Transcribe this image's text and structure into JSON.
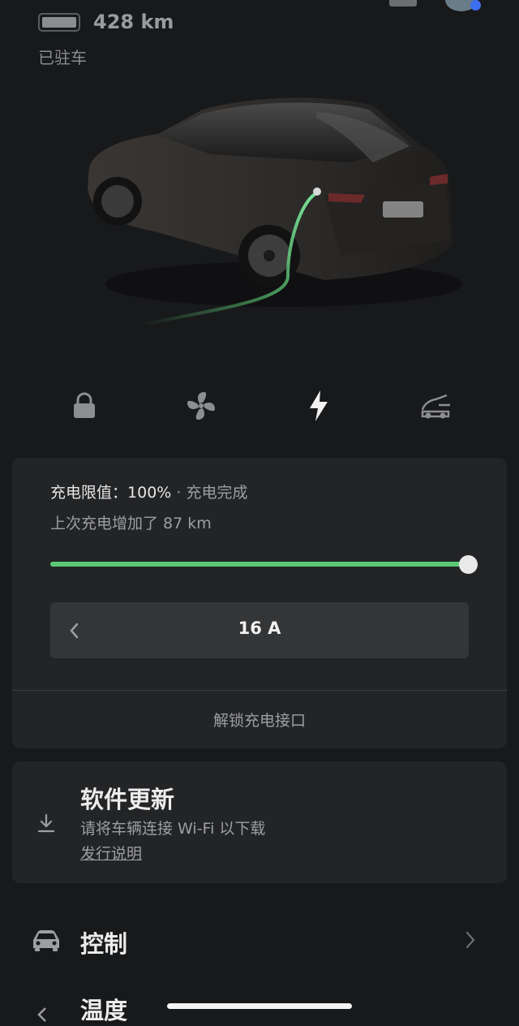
{
  "status": {
    "range": "428 km",
    "park_state": "已驻车"
  },
  "quick_actions": [
    {
      "icon": "lock-icon"
    },
    {
      "icon": "fan-icon"
    },
    {
      "icon": "charge-bolt-icon"
    },
    {
      "icon": "frunk-open-icon"
    }
  ],
  "charging": {
    "limit_label": "充电限值：",
    "limit_value": "100%",
    "separator": "·",
    "status": "充电完成",
    "last_added": "上次充电增加了 87 km",
    "charge_limit_percent": 100,
    "current": "16 A",
    "unlock_port": "解锁充电接口"
  },
  "software_update": {
    "title": "软件更新",
    "description": "请将车辆连接 Wi-Fi 以下载",
    "release_notes": "发行说明"
  },
  "menu": {
    "control": "控制",
    "climate": "温度"
  },
  "colors": {
    "background": "#18191b",
    "card": "#232426",
    "accent_green": "#5cc875",
    "notification_blue": "#3d6ef0"
  }
}
